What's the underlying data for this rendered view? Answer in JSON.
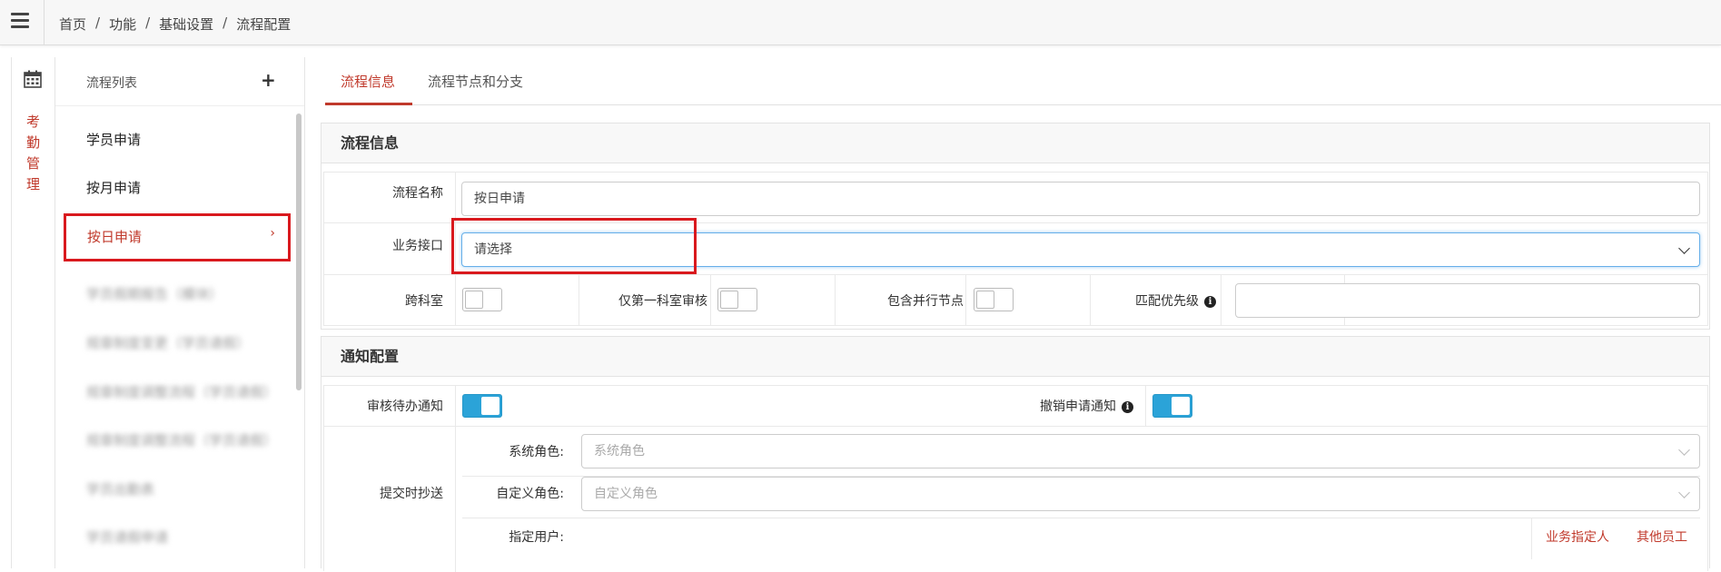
{
  "breadcrumb": {
    "items": [
      "首页",
      "功能",
      "基础设置",
      "流程配置"
    ]
  },
  "rail": {
    "module_label": "考勤管理"
  },
  "list": {
    "title": "流程列表",
    "items": [
      {
        "label": "学员申请"
      },
      {
        "label": "按月申请"
      },
      {
        "label": "按日申请"
      },
      {
        "label": "学员假期报告（模块）"
      },
      {
        "label": "规章制度变更（学员请假）"
      },
      {
        "label": "规章制度调整流程（学员请假）"
      },
      {
        "label": "规章制度调整流程（学员请假）"
      },
      {
        "label": "学员出勤表"
      },
      {
        "label": "学员请假申请"
      }
    ]
  },
  "tabs": [
    {
      "label": "流程信息"
    },
    {
      "label": "流程节点和分支"
    }
  ],
  "flow_info": {
    "section_title": "流程信息",
    "name_label": "流程名称",
    "name_value": "按日申请",
    "interface_label": "业务接口",
    "interface_value": "请选择",
    "cross_dept_label": "跨科室",
    "first_dept_label": "仅第一科室审核",
    "parallel_label": "包含并行节点",
    "priority_label": "匹配优先级",
    "priority_value": ""
  },
  "notify": {
    "section_title": "通知配置",
    "pending_label": "审核待办通知",
    "revoke_label": "撤销申请通知",
    "cc_label": "提交时抄送",
    "sys_role_label": "系统角色:",
    "sys_role_placeholder": "系统角色",
    "custom_role_label": "自定义角色:",
    "custom_role_placeholder": "自定义角色",
    "user_label": "指定用户:",
    "biz_person_link": "业务指定人",
    "other_staff_link": "其他员工"
  }
}
